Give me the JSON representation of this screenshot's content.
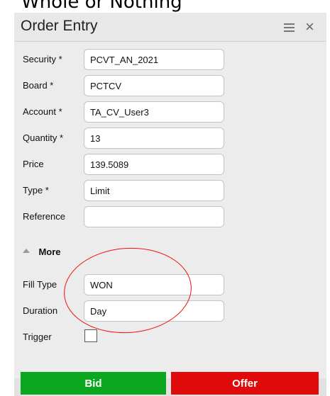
{
  "caption": "Whole or Nothing",
  "header": {
    "title": "Order Entry",
    "menu_icon": "hamburger-icon",
    "close_icon": "close-icon",
    "close_glyph": "×"
  },
  "fields": {
    "security": {
      "label": "Security *",
      "value": "PCVT_AN_2021"
    },
    "board": {
      "label": "Board *",
      "value": "PCTCV"
    },
    "account": {
      "label": "Account *",
      "value": "TA_CV_User3"
    },
    "quantity": {
      "label": "Quantity *",
      "value": "13"
    },
    "price": {
      "label": "Price",
      "value": "139.5089"
    },
    "type": {
      "label": "Type *",
      "value": "Limit"
    },
    "reference": {
      "label": "Reference",
      "value": ""
    }
  },
  "more": {
    "label": "More",
    "icon": "caret-up-icon"
  },
  "more_fields": {
    "fill_type": {
      "label": "Fill Type",
      "value": "WON"
    },
    "duration": {
      "label": "Duration",
      "value": "Day"
    },
    "trigger": {
      "label": "Trigger",
      "checked": false
    }
  },
  "actions": {
    "bid_label": "Bid",
    "offer_label": "Offer"
  },
  "colors": {
    "bid": "#0ba71f",
    "offer": "#e00a0a",
    "panel_bg": "#e8e8e8",
    "annotation": "#e11111"
  }
}
